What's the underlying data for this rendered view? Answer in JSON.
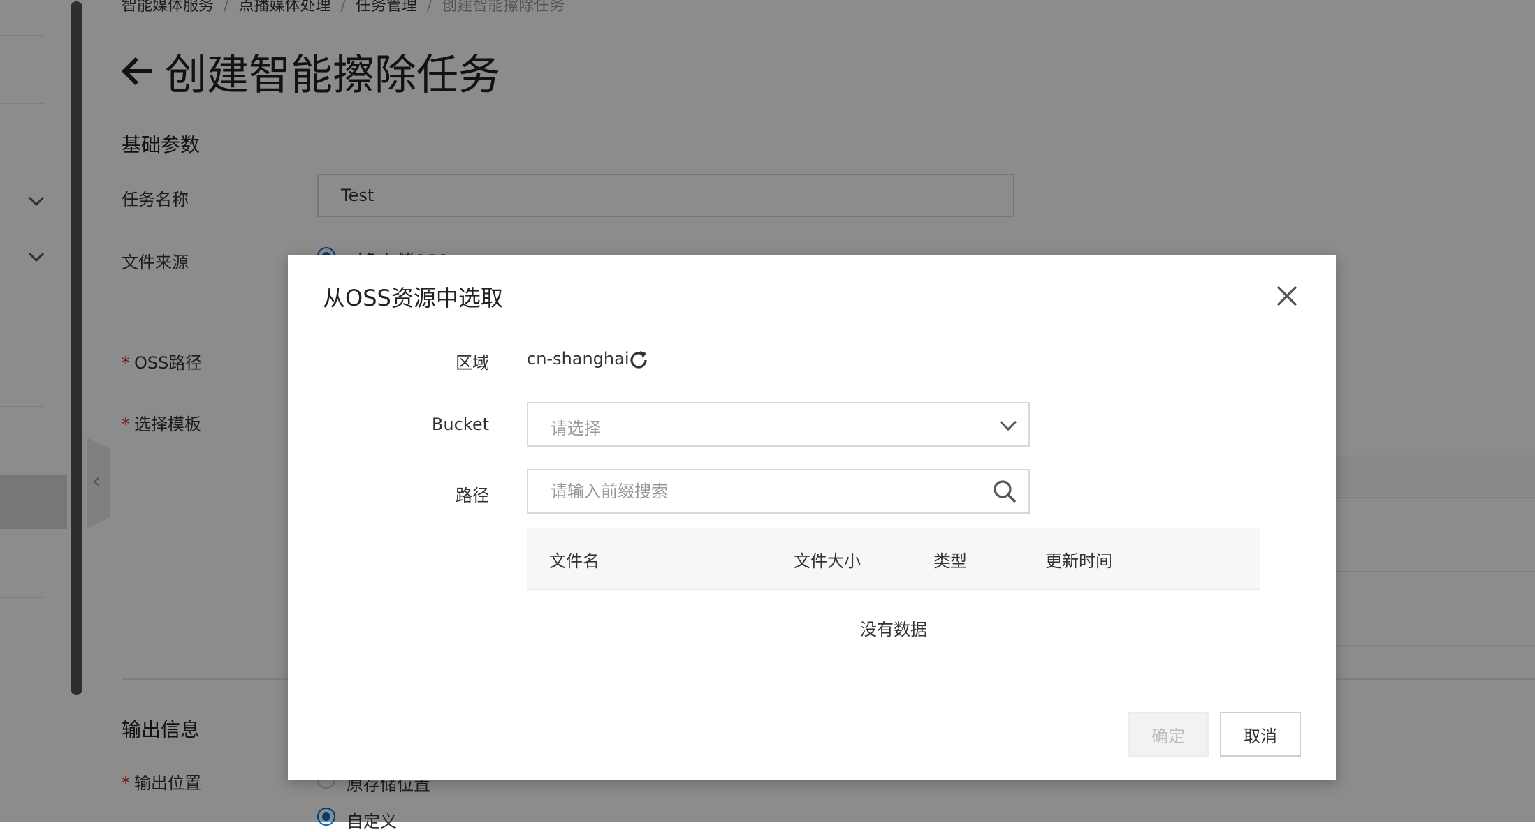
{
  "breadcrumb": {
    "items": [
      "智能媒体服务",
      "点播媒体处理",
      "任务管理"
    ],
    "current": "创建智能擦除任务",
    "separator": "/"
  },
  "page": {
    "title": "创建智能擦除任务",
    "sections": {
      "basic": "基础参数",
      "output": "输出信息"
    },
    "fields": {
      "task_name_label": "任务名称",
      "task_name_value": "Test",
      "file_source_label": "文件来源",
      "file_source_option": "对象存储OSS",
      "oss_path_label": "OSS路径",
      "template_label": "选择模板",
      "output_location_label": "输出位置",
      "output_option_original": "原存储位置",
      "output_option_custom": "自定义"
    },
    "required_mark": "*"
  },
  "dialog": {
    "title": "从OSS资源中选取",
    "region_label": "区域",
    "region_value": "cn-shanghai",
    "bucket_label": "Bucket",
    "bucket_placeholder": "请选择",
    "path_label": "路径",
    "path_placeholder": "请输入前缀搜索",
    "table": {
      "columns": [
        "文件名",
        "文件大小",
        "类型",
        "更新时间"
      ],
      "rows": [],
      "empty_text": "没有数据"
    },
    "confirm_label": "确定",
    "cancel_label": "取消"
  },
  "icons": {
    "back": "back-arrow-icon",
    "close": "close-icon",
    "refresh": "refresh-icon",
    "dropdown": "chevron-down-icon",
    "search": "search-icon",
    "collapse": "chevron-left-icon"
  },
  "colors": {
    "accent": "#0070cc",
    "required": "#e02020",
    "overlay": "rgba(0,0,0,0.45)"
  }
}
